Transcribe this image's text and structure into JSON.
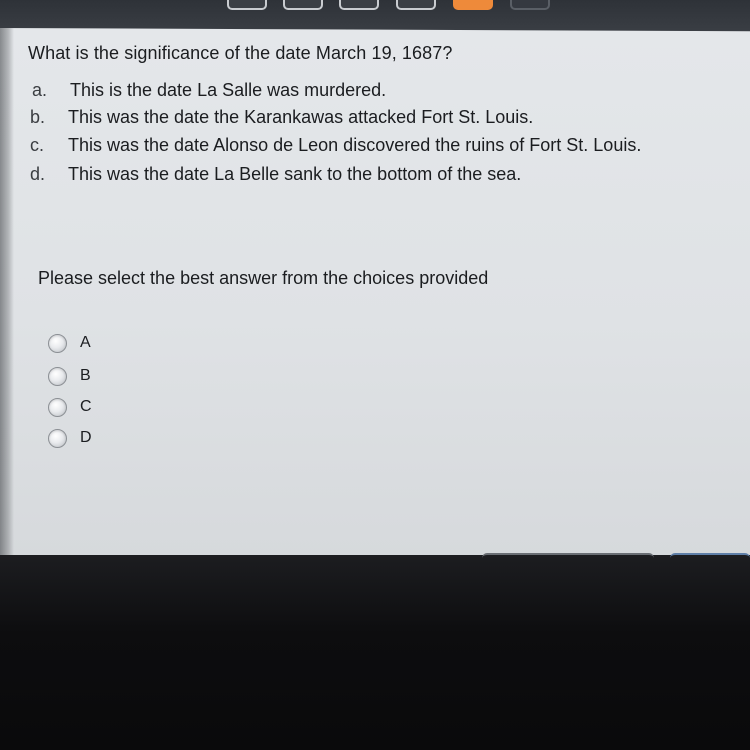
{
  "question": {
    "text": "What is the significance of the date March 19, 1687?",
    "options": [
      {
        "letter": "a.",
        "text": "This is the date La Salle was murdered."
      },
      {
        "letter": "b.",
        "text": "This was the date the Karankawas attacked Fort St. Louis."
      },
      {
        "letter": "c.",
        "text": "This was the date Alonso de Leon discovered the ruins of Fort St. Louis."
      },
      {
        "letter": "d.",
        "text": "This was the date La Belle sank to the bottom of the sea."
      }
    ]
  },
  "answer": {
    "prompt": "Please select the best answer from the choices provided",
    "choices": [
      "A",
      "B",
      "C",
      "D"
    ],
    "selected": null
  },
  "colors": {
    "accent": "#ee8a3a",
    "panel": "#e2e5e8",
    "background": "#111214"
  }
}
